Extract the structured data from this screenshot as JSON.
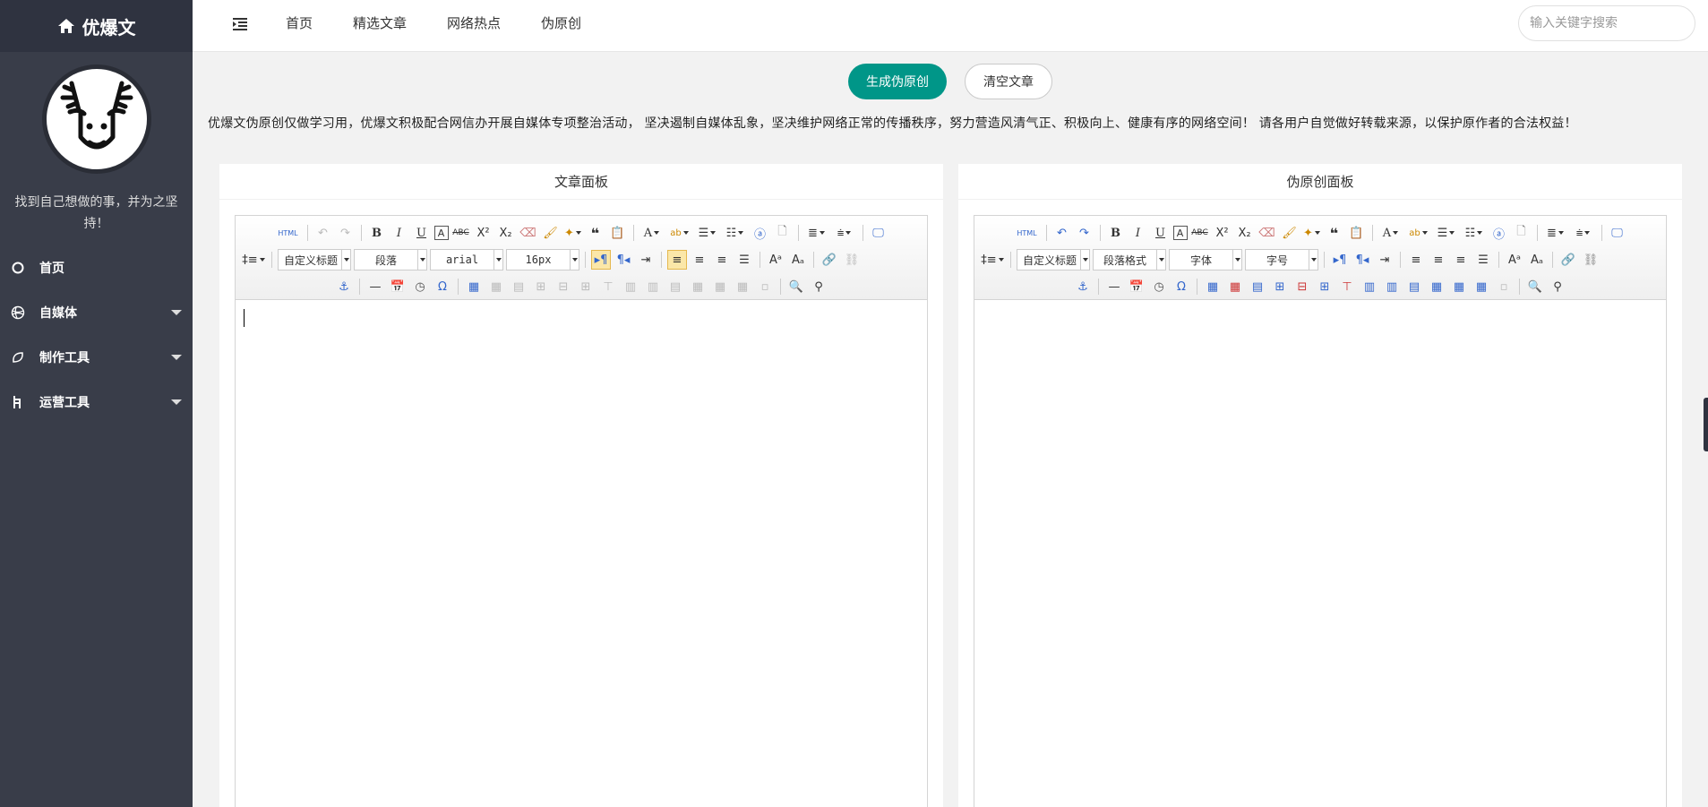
{
  "sidebar": {
    "brand": "优爆文",
    "slogan": "找到自己想做的事，并为之坚持！",
    "items": [
      {
        "label": "首页",
        "icon": "circle-icon"
      },
      {
        "label": "自媒体",
        "icon": "globe-icon"
      },
      {
        "label": "制作工具",
        "icon": "leaf-icon"
      },
      {
        "label": "运营工具",
        "icon": "tools-icon"
      }
    ]
  },
  "topbar": {
    "nav": [
      "首页",
      "精选文章",
      "网络热点",
      "伪原创"
    ],
    "search_placeholder": "输入关键字搜索"
  },
  "actions": {
    "generate": "生成伪原创",
    "clear": "清空文章"
  },
  "notice": "优爆文伪原创仅做学习用，优爆文积极配合网信办开展自媒体专项整治活动， 坚决遏制自媒体乱象，坚决维护网络正常的传播秩序，努力营造风清气正、积极向上、健康有序的网络空间！ 请各用户自觉做好转载来源，以保护原作者的合法权益！",
  "panels": {
    "left": {
      "title": "文章面板",
      "combos": [
        "自定义标题",
        "段落",
        "arial",
        "16px"
      ]
    },
    "right": {
      "title": "伪原创面板",
      "combos": [
        "自定义标题",
        "段落格式",
        "字体",
        "字号"
      ]
    }
  },
  "toolbar_labels": {
    "html": "HTML",
    "bold": "B",
    "italic": "I",
    "underline": "U",
    "strike": "ABC",
    "font_color": "A"
  },
  "colors": {
    "sidebar": "#393d49",
    "accent": "#009688"
  }
}
